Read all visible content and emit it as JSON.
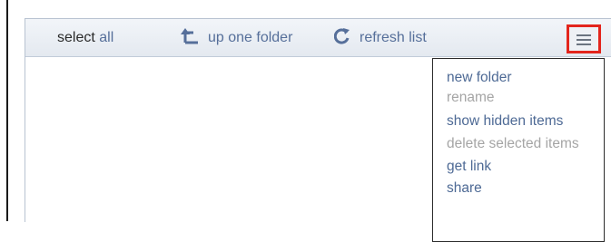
{
  "toolbar": {
    "select_word": "select",
    "select_all_word": "all",
    "up_folder_label": "up one folder",
    "refresh_label": "refresh list"
  },
  "menu": {
    "items": [
      {
        "label": "new folder",
        "enabled": true
      },
      {
        "label": "rename",
        "enabled": false
      },
      {
        "label": "show hidden items",
        "enabled": true
      },
      {
        "label": "delete selected items",
        "enabled": false
      },
      {
        "label": "get link",
        "enabled": true
      },
      {
        "label": "share",
        "enabled": true
      }
    ]
  },
  "colors": {
    "link": "#4e6a95",
    "disabled": "#a5a5a5",
    "highlight": "#e3251c"
  },
  "icons": {
    "up_folder": "up-arrow-icon",
    "refresh": "refresh-icon",
    "menu": "hamburger-menu-icon"
  }
}
